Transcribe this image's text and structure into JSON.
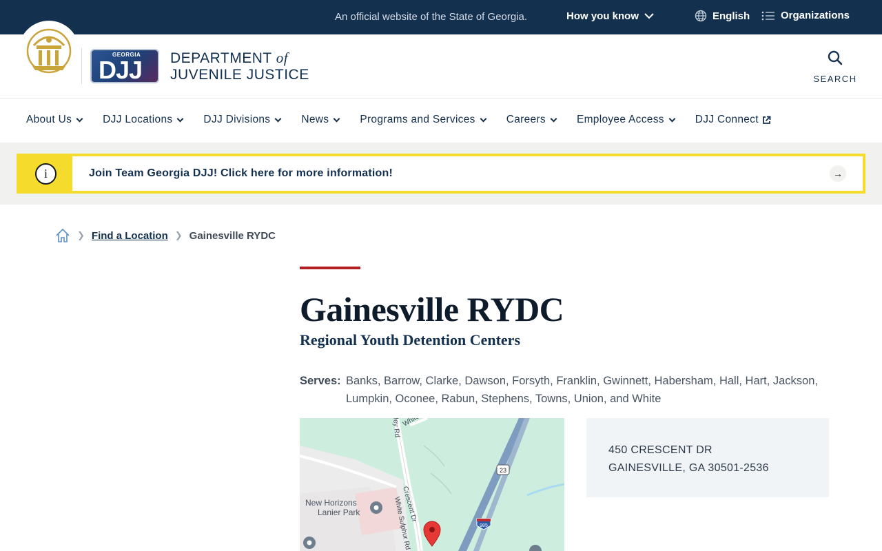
{
  "topbar": {
    "official_text": "An official website of the State of Georgia.",
    "how_you_know": "How you know",
    "language": "English",
    "organizations": "Organizations"
  },
  "header": {
    "logo_line_1": "DEPARTMENT",
    "logo_of": "of",
    "logo_line_2": "JUVENILE JUSTICE",
    "djj_badge_top": "GEORGIA",
    "djj_badge": "DJJ",
    "search_label": "SEARCH"
  },
  "nav": {
    "items": [
      {
        "label": "About Us"
      },
      {
        "label": "DJJ Locations"
      },
      {
        "label": "DJJ Divisions"
      },
      {
        "label": "News"
      },
      {
        "label": "Programs and Services"
      },
      {
        "label": "Careers"
      },
      {
        "label": "Employee Access"
      },
      {
        "label": "DJJ Connect"
      }
    ]
  },
  "alert": {
    "message": "Join Team Georgia DJJ! Click here for more information!"
  },
  "breadcrumb": {
    "link": "Find a Location",
    "current": "Gainesville RYDC"
  },
  "page": {
    "title": "Gainesville RYDC",
    "subtitle": "Regional Youth Detention Centers",
    "serves_label": "Serves:",
    "serves_value": "Banks, Barrow, Clarke, Dawson, Forsyth, Franklin, Gwinnett, Habersham, Hall, Hart, Jackson, Lumpkin, Oconee, Rabun, Stephens, Towns, Union, and White"
  },
  "address": {
    "line1": "450 CRESCENT DR",
    "line2": "GAINESVILLE, GA 30501-2536"
  },
  "map": {
    "labels": {
      "park": "New Horizons",
      "park2": "Lanier Park",
      "road1": "Crescent Dr",
      "road2": "White Sulphur Rd",
      "road3": "White",
      "road4": "ley Rd",
      "route23": "23",
      "route985": "985"
    }
  },
  "colors": {
    "navy": "#13304f",
    "alert_yellow": "#f5dc2c",
    "accent_red": "#b41f24",
    "gold": "#c9a43a"
  }
}
